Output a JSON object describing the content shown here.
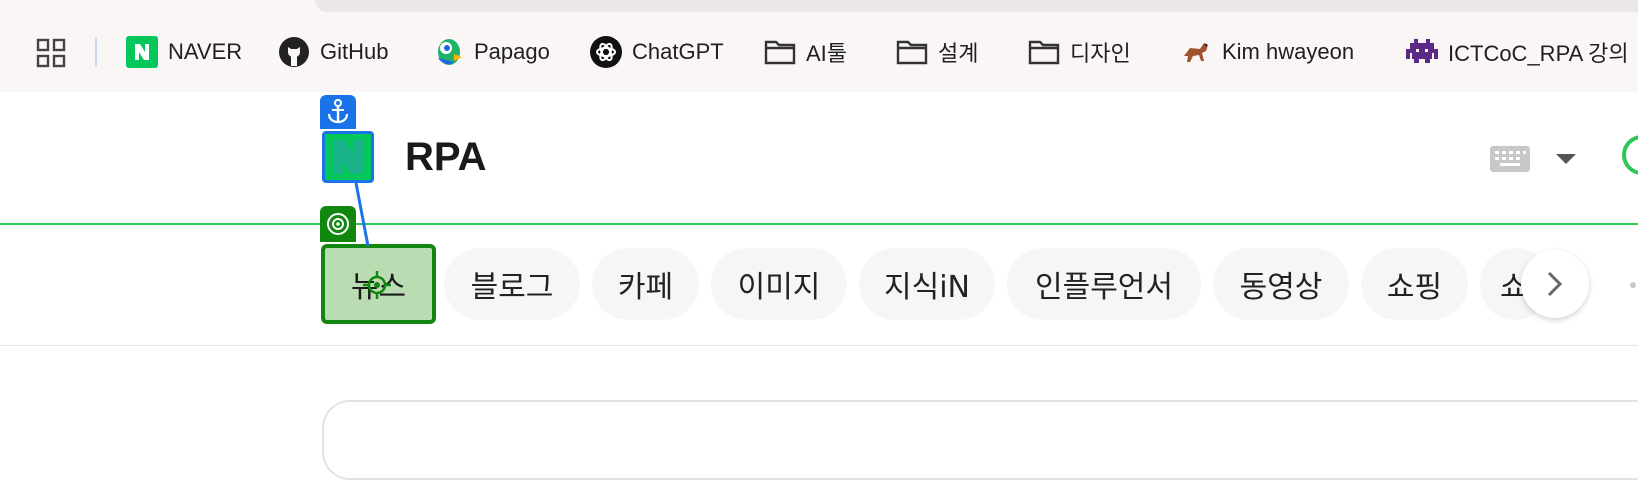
{
  "bookmarks_bar": {
    "items": [
      {
        "label": "NAVER",
        "icon": "naver-icon"
      },
      {
        "label": "GitHub",
        "icon": "github-icon"
      },
      {
        "label": "Papago",
        "icon": "papago-icon"
      },
      {
        "label": "ChatGPT",
        "icon": "chatgpt-icon"
      },
      {
        "label": "AI툴",
        "icon": "folder-icon"
      },
      {
        "label": "설계",
        "icon": "folder-icon"
      },
      {
        "label": "디자인",
        "icon": "folder-icon"
      },
      {
        "label": "Kim hwayeon",
        "icon": "horse-icon"
      },
      {
        "label": "ICTCoC_RPA 강의",
        "icon": "space-invader-icon"
      }
    ]
  },
  "search": {
    "query": "RPA",
    "brand_color": "#03c75a"
  },
  "tabs": {
    "items": [
      {
        "label": "뉴스",
        "active": true
      },
      {
        "label": "블로그"
      },
      {
        "label": "카페"
      },
      {
        "label": "이미지"
      },
      {
        "label": "지식iN"
      },
      {
        "label": "인플루언서"
      },
      {
        "label": "동영상"
      },
      {
        "label": "쇼핑"
      },
      {
        "label": "쇼"
      }
    ]
  },
  "overlay": {
    "anchor_color": "#1a73e8",
    "target_color": "#11870f"
  }
}
